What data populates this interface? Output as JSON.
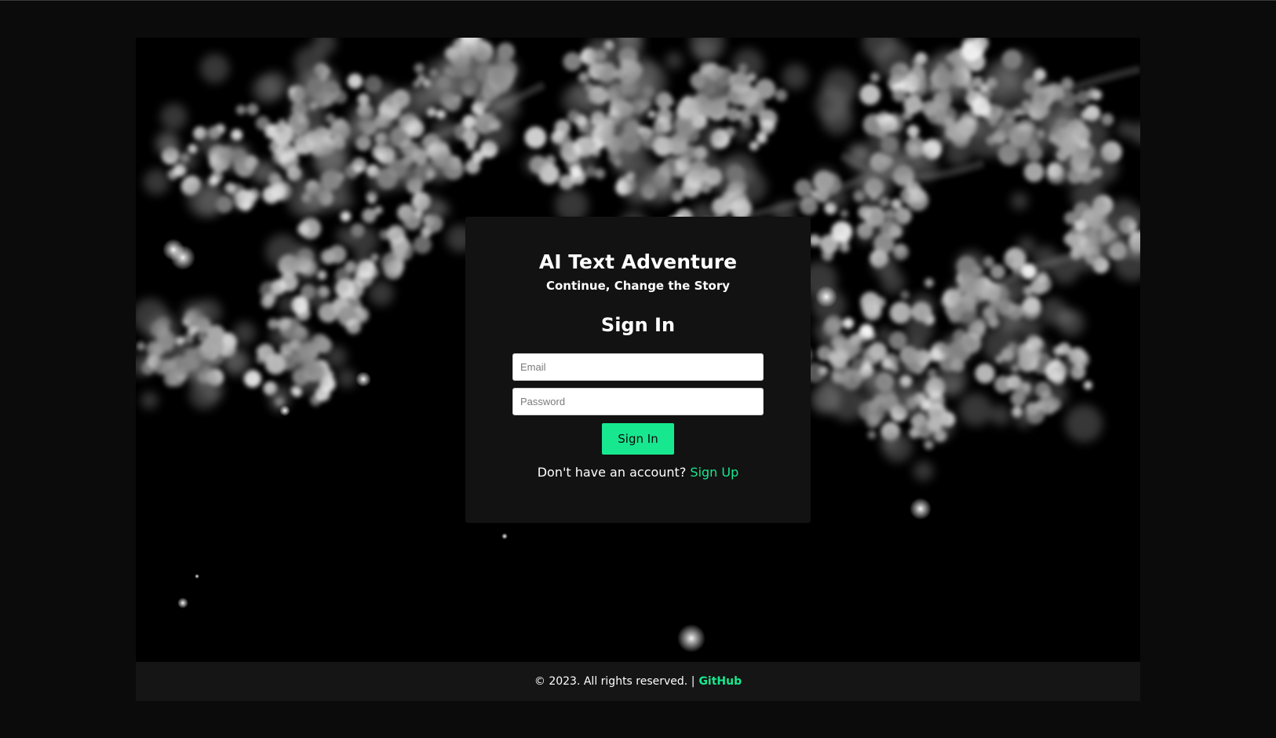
{
  "app": {
    "title": "AI Text Adventure",
    "subtitle": "Continue, Change the Story"
  },
  "auth": {
    "heading": "Sign In",
    "email_placeholder": "Email",
    "password_placeholder": "Password",
    "submit_label": "Sign In",
    "switch_prompt": "Don't have an account?",
    "switch_link": "Sign Up"
  },
  "footer": {
    "copyright": "© 2023. All rights reserved. |",
    "github_link": "GitHub"
  },
  "colors": {
    "accent": "#17e88f",
    "card_bg": "#121212",
    "page_bg": "#0b0b0b",
    "footer_bg": "#151515"
  },
  "icons": {
    "background": "cherry-blossom-image"
  }
}
